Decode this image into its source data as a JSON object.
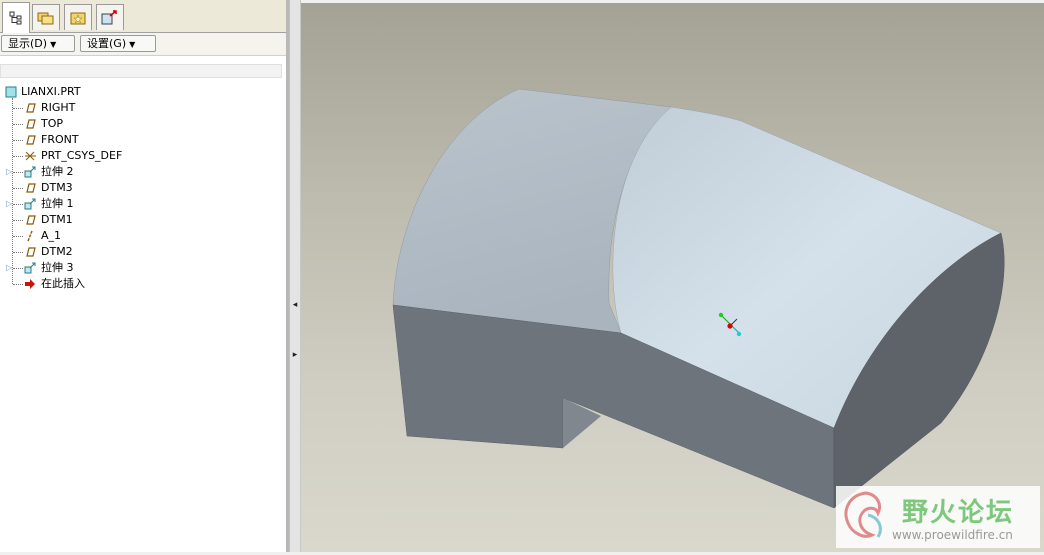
{
  "tabs": [
    {
      "name": "model-tree-tab",
      "icon": "model-tree-icon",
      "active": true
    },
    {
      "name": "folder-browser-tab",
      "icon": "folder-browser-icon",
      "active": false
    },
    {
      "name": "favorites-tab",
      "icon": "favorites-icon",
      "active": false
    },
    {
      "name": "connections-tab",
      "icon": "connections-icon",
      "active": false
    }
  ],
  "toolbar": {
    "show_label": "显示(D)",
    "settings_label": "设置(G)"
  },
  "tree": {
    "root": "LIANXI.PRT",
    "items": [
      {
        "label": "RIGHT",
        "icon": "datum-plane-icon",
        "expandable": false
      },
      {
        "label": "TOP",
        "icon": "datum-plane-icon",
        "expandable": false
      },
      {
        "label": "FRONT",
        "icon": "datum-plane-icon",
        "expandable": false
      },
      {
        "label": "PRT_CSYS_DEF",
        "icon": "csys-icon",
        "expandable": false
      },
      {
        "label": "拉伸 2",
        "icon": "extrude-icon",
        "expandable": true
      },
      {
        "label": "DTM3",
        "icon": "datum-plane-icon",
        "expandable": false
      },
      {
        "label": "拉伸 1",
        "icon": "extrude-icon",
        "expandable": true
      },
      {
        "label": "DTM1",
        "icon": "datum-plane-icon",
        "expandable": false
      },
      {
        "label": "A_1",
        "icon": "datum-axis-icon",
        "expandable": false
      },
      {
        "label": "DTM2",
        "icon": "datum-plane-icon",
        "expandable": false
      },
      {
        "label": "拉伸 3",
        "icon": "extrude-icon",
        "expandable": true
      },
      {
        "label": "在此插入",
        "icon": "insert-here-icon",
        "expandable": false
      }
    ]
  },
  "watermark": {
    "title": "野火论坛",
    "url": "www.proewildfire.cn"
  },
  "colors": {
    "viewport_top": "#a4a295",
    "viewport_bottom": "#d9d8cc",
    "model_light": "#c6d4de",
    "model_dark": "#6c737b",
    "accent_arrow": "#cc0000"
  }
}
